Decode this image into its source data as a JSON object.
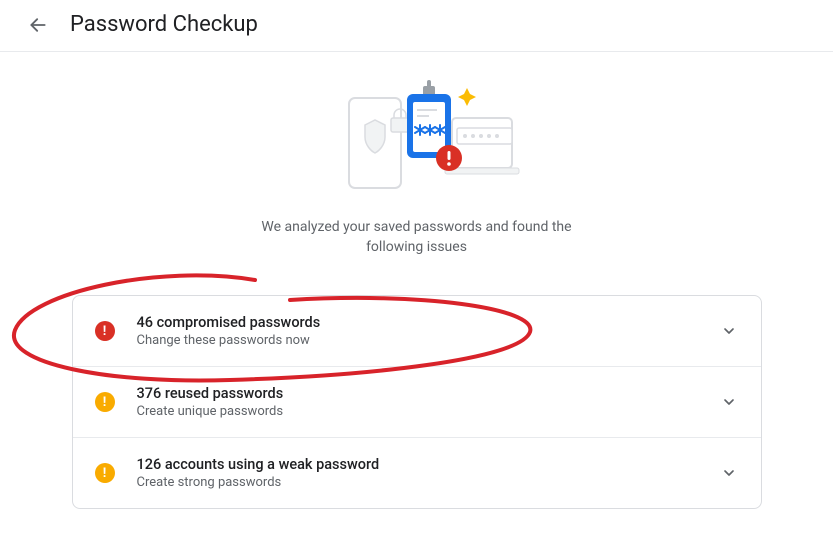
{
  "header": {
    "title": "Password Checkup"
  },
  "subtitle_line1": "We analyzed your saved passwords and found the",
  "subtitle_line2": "following issues",
  "issues": [
    {
      "severity": "red",
      "title": "46 compromised passwords",
      "subtitle": "Change these passwords now"
    },
    {
      "severity": "yellow",
      "title": "376 reused passwords",
      "subtitle": "Create unique passwords"
    },
    {
      "severity": "yellow",
      "title": "126 accounts using a weak password",
      "subtitle": "Create strong passwords"
    }
  ]
}
